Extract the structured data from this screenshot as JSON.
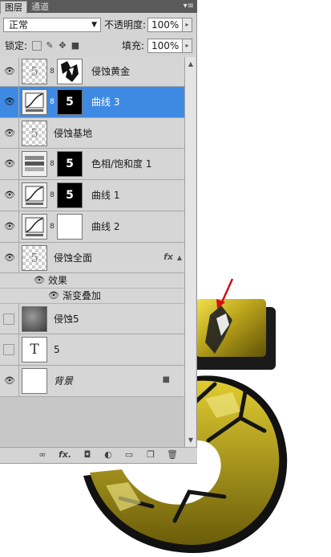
{
  "panel": {
    "tabs": [
      "图层",
      "通道"
    ],
    "menu_icon": "panel-menu-icon",
    "blend_mode": "正常",
    "opacity_label": "不透明度:",
    "opacity_value": "100%",
    "lock_label": "锁定:",
    "fill_label": "填充:",
    "fill_value": "100%"
  },
  "layers": [
    {
      "name": "侵蚀黄金",
      "visible": true,
      "thumb": "checker-5",
      "mask": "white-rock"
    },
    {
      "name": "曲线 3",
      "visible": true,
      "thumb": "curves",
      "mask": "black-5",
      "selected": true
    },
    {
      "name": "侵蚀基地",
      "visible": true,
      "thumb": "checker-5"
    },
    {
      "name": "色相/饱和度 1",
      "visible": true,
      "thumb": "hue-sat",
      "mask": "black-5"
    },
    {
      "name": "曲线 1",
      "visible": true,
      "thumb": "curves",
      "mask": "black-5"
    },
    {
      "name": "曲线 2",
      "visible": true,
      "thumb": "curves",
      "mask": "white"
    },
    {
      "name": "侵蚀全面",
      "visible": true,
      "thumb": "checker-5",
      "fx": "fx"
    },
    {
      "name": "侵蚀5",
      "visible": false,
      "thumb": "stone"
    },
    {
      "name": "5",
      "visible": false,
      "thumb": "text-T"
    },
    {
      "name": "背景",
      "visible": true,
      "thumb": "white",
      "locked": true
    }
  ],
  "effects": {
    "label": "效果",
    "items": [
      "渐变叠加"
    ]
  },
  "thumb_text": {
    "five": "5",
    "type_t": "T"
  },
  "glyphs": {
    "eye": "👁",
    "chain": "8",
    "fx": "fx",
    "lock": "🔒",
    "dropdown": "▼",
    "stepper": "▸",
    "up": "▲",
    "down": "▼"
  },
  "bottom_icons": [
    "link-layers-icon",
    "fx-icon",
    "mask-icon",
    "adjustment-icon",
    "group-icon",
    "new-layer-icon",
    "delete-icon"
  ],
  "colors": {
    "selection": "#3e8ae3",
    "gold": "#b8a21a",
    "arrow": "#d01010"
  }
}
